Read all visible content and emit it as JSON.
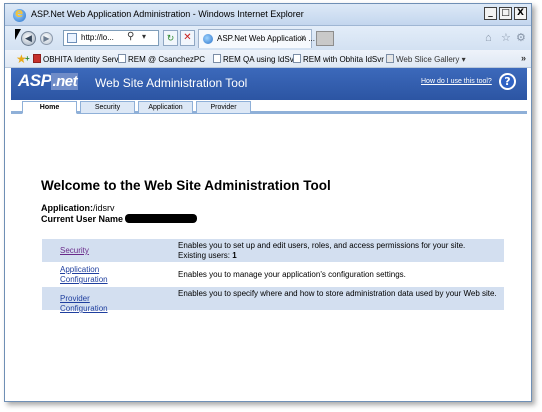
{
  "window": {
    "title": "ASP.Net Web Application Administration - Windows Internet Explorer",
    "min": "_",
    "max": "□",
    "close": "X"
  },
  "browser": {
    "address": "http://lo...",
    "tab_title": "ASP.Net Web Application ...",
    "tab_close": "x",
    "icons": [
      "back-arrow-icon",
      "forward-arrow-icon",
      "search-icon",
      "refresh-icon",
      "stop-icon",
      "home-icon",
      "favorites-star-icon",
      "tools-gear-icon"
    ]
  },
  "favorites": [
    {
      "label": "OBHITA Identity Server"
    },
    {
      "label": "REM @ CsanchezPC"
    },
    {
      "label": "REM QA using IdSv"
    },
    {
      "label": "REM with Obhita IdSvr"
    },
    {
      "label": "Web Slice Gallery ▾"
    }
  ],
  "app": {
    "logo": "ASP",
    "logo_suffix": ".net",
    "banner_title": "Web Site Administration Tool",
    "help_link": "How do I use this tool?",
    "help_icon": "?",
    "tabs": [
      {
        "label": "Home",
        "active": true
      },
      {
        "label": "Security"
      },
      {
        "label": "Application"
      },
      {
        "label": "Provider"
      }
    ]
  },
  "main": {
    "welcome": "Welcome to the Web Site Administration Tool",
    "application_label": "Application:",
    "application_value": "/idsrv",
    "user_label": "Current User Name",
    "rows": [
      {
        "link": "Security",
        "desc": "Enables you to set up and edit users, roles, and access permissions for your site.",
        "extra_label": "Existing users: ",
        "extra_value": "1"
      },
      {
        "link": "Application Configuration",
        "desc": "Enables you to manage your application's configuration settings."
      },
      {
        "link": "Provider Configuration",
        "desc": "Enables you to specify where and how to store administration data used by your Web site."
      }
    ]
  }
}
